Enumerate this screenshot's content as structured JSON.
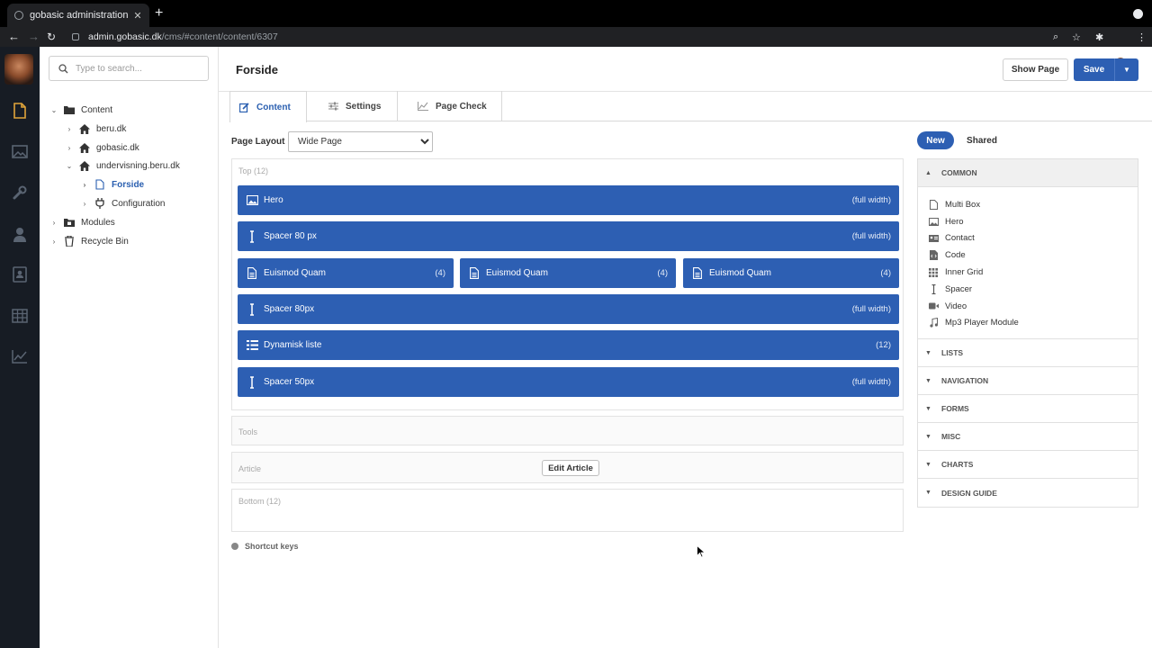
{
  "browser": {
    "tab_title": "gobasic administration",
    "url_host": "admin.gobasic.dk",
    "url_path": "/cms/#content/content/6307"
  },
  "search": {
    "placeholder": "Type to search..."
  },
  "tree": {
    "items": [
      {
        "label": "Content",
        "icon": "folder-icon",
        "expanded": true
      },
      {
        "label": "beru.dk",
        "icon": "home-icon",
        "expanded": false
      },
      {
        "label": "gobasic.dk",
        "icon": "home-icon",
        "expanded": false
      },
      {
        "label": "undervisning.beru.dk",
        "icon": "home-icon",
        "expanded": true
      },
      {
        "label": "Forside",
        "icon": "page-icon",
        "active": true
      },
      {
        "label": "Configuration",
        "icon": "plug-icon"
      },
      {
        "label": "Modules",
        "icon": "modules-folder-icon"
      },
      {
        "label": "Recycle Bin",
        "icon": "trash-icon"
      }
    ]
  },
  "page": {
    "title": "Forside",
    "show_page_label": "Show Page",
    "save_label": "Save"
  },
  "tabs": [
    {
      "label": "Content",
      "active": true
    },
    {
      "label": "Settings"
    },
    {
      "label": "Page Check"
    }
  ],
  "layout": {
    "label": "Page Layout",
    "selected": "Wide Page"
  },
  "zones": {
    "top": {
      "label": "Top (12)",
      "blocks": [
        {
          "name": "Hero",
          "width": "(full width)",
          "icon": "image-icon"
        },
        {
          "name": "Spacer 80 px",
          "width": "(full width)",
          "icon": "spacer-icon"
        },
        {
          "name": "Euismod Quam",
          "width": "(4)",
          "icon": "document-icon"
        },
        {
          "name": "Euismod Quam",
          "width": "(4)",
          "icon": "document-icon"
        },
        {
          "name": "Euismod Quam",
          "width": "(4)",
          "icon": "document-icon"
        },
        {
          "name": "Spacer 80px",
          "width": "(full width)",
          "icon": "spacer-icon"
        },
        {
          "name": "Dynamisk liste",
          "width": "(12)",
          "icon": "list-icon"
        },
        {
          "name": "Spacer 50px",
          "width": "(full width)",
          "icon": "spacer-icon"
        }
      ]
    },
    "tools": {
      "label": "Tools"
    },
    "article": {
      "label": "Article",
      "edit_label": "Edit Article"
    },
    "bottom": {
      "label": "Bottom (12)"
    }
  },
  "shortcut_label": "Shortcut keys",
  "panel": {
    "new_label": "New",
    "shared_label": "Shared",
    "common_label": "COMMON",
    "common_items": [
      {
        "label": "Multi Box",
        "icon": "document-icon"
      },
      {
        "label": "Hero",
        "icon": "image-icon"
      },
      {
        "label": "Contact",
        "icon": "contact-card-icon"
      },
      {
        "label": "Code",
        "icon": "code-file-icon"
      },
      {
        "label": "Inner Grid",
        "icon": "grid-icon"
      },
      {
        "label": "Spacer",
        "icon": "spacer-icon"
      },
      {
        "label": "Video",
        "icon": "video-icon"
      },
      {
        "label": "Mp3 Player Module",
        "icon": "music-icon"
      }
    ],
    "categories": [
      "LISTS",
      "NAVIGATION",
      "FORMS",
      "MISC",
      "CHARTS",
      "DESIGN GUIDE"
    ]
  },
  "colors": {
    "accent": "#2d5fb3",
    "rail": "#171c24"
  }
}
